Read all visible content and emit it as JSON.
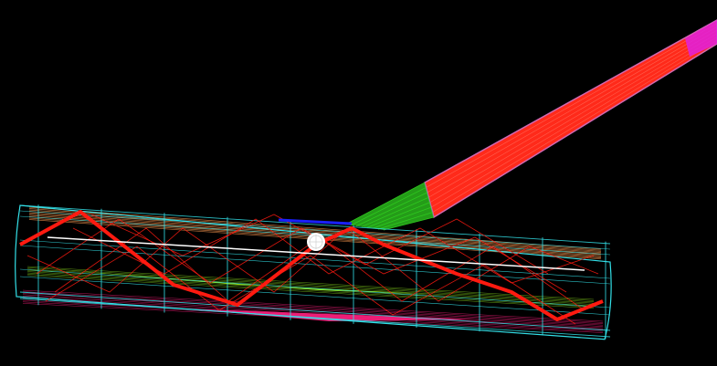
{
  "viewport": {
    "background": "#000000"
  },
  "colors": {
    "frame": "#33e0e8",
    "shaft_outline": "#c060c8",
    "shaft_fill": "#ff2a1a",
    "grip": "#e020e0",
    "hosel": "#30d020",
    "zigzag": "#ff1a10",
    "top_band": "#ff9a50",
    "mid_band": "#a0ff20",
    "bottom_band": "#ff2080",
    "blue_accent": "#1a20ff",
    "white_line": "#ffffff",
    "marker": "#ffffff"
  },
  "icons": {
    "marker": "sphere-marker-icon"
  }
}
